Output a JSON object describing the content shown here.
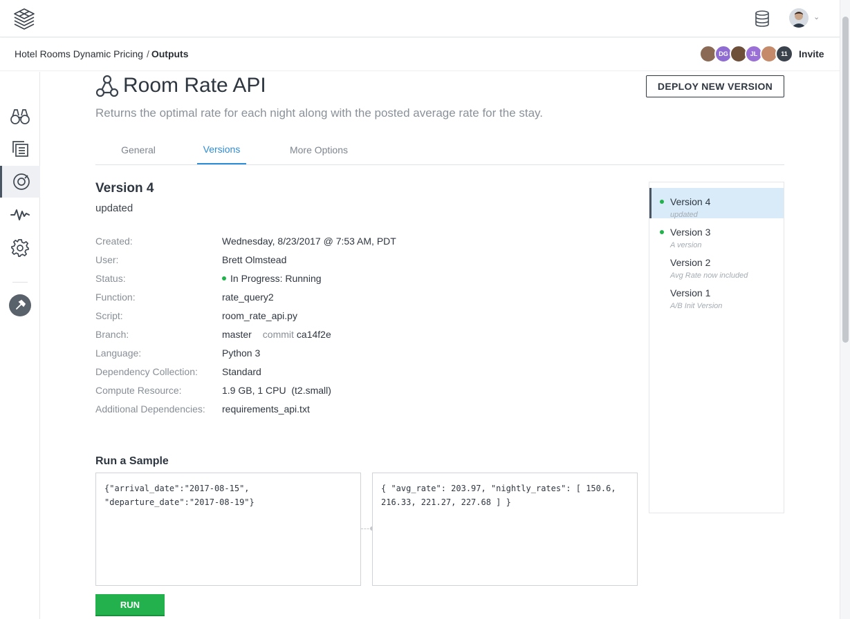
{
  "topbar": {
    "logo_icon": "stacked-layers-logo-icon",
    "database_icon": "database-icon",
    "user_menu_chevron": "⌄"
  },
  "breadcrumb": {
    "project": "Hotel Rooms Dynamic Pricing",
    "separator": "/",
    "current": "Outputs"
  },
  "collaborators": [
    {
      "initials": "",
      "color": "#8a6a55"
    },
    {
      "initials": "DG",
      "color": "#8e6cd1"
    },
    {
      "initials": "",
      "color": "#6d4f3a"
    },
    {
      "initials": "JL",
      "color": "#9a6fd6"
    },
    {
      "initials": "",
      "color": "#c48a6a"
    },
    {
      "initials": "11",
      "color": "#3a424c"
    }
  ],
  "invite_label": "Invite",
  "rail": {
    "items": [
      {
        "icon": "binoculars-icon",
        "active": false
      },
      {
        "icon": "documents-icon",
        "active": false
      },
      {
        "icon": "outputs-icon",
        "active": true
      },
      {
        "icon": "activity-icon",
        "active": false
      },
      {
        "icon": "gear-icon",
        "active": false
      }
    ],
    "tool_icon": "hammer-icon"
  },
  "header": {
    "title": "Room Rate API",
    "title_icon": "api-nodes-icon",
    "subtitle": "Returns the optimal rate for each night along with the posted average rate for the stay.",
    "deploy_button": "DEPLOY NEW VERSION"
  },
  "tabs": [
    {
      "label": "General",
      "active": false
    },
    {
      "label": "Versions",
      "active": true
    },
    {
      "label": "More Options",
      "active": false
    }
  ],
  "version": {
    "title": "Version 4",
    "subtitle": "updated",
    "details": [
      {
        "label": "Created:",
        "value": "Wednesday, 8/23/2017 @ 7:53 AM, PDT"
      },
      {
        "label": "User:",
        "value": "Brett Olmstead"
      },
      {
        "label": "Status:",
        "value": "In Progress: Running"
      },
      {
        "label": "Function:",
        "value": "rate_query2"
      },
      {
        "label": "Script:",
        "value": "room_rate_api.py"
      },
      {
        "label": "Branch:",
        "value": "master",
        "extra_label": "commit",
        "extra_value": "ca14f2e"
      },
      {
        "label": "Language:",
        "value": "Python 3"
      },
      {
        "label": "Dependency Collection:",
        "value": "Standard"
      },
      {
        "label": "Compute Resource:",
        "value": "1.9 GB, 1 CPU  (t2.small)"
      },
      {
        "label": "Additional Dependencies:",
        "value": "requirements_api.txt"
      }
    ],
    "status_color": "#21b24b"
  },
  "sample": {
    "title": "Run a Sample",
    "input": "{\"arrival_date\":\"2017-08-15\",\n\"departure_date\":\"2017-08-19\"}",
    "output": "{ \"avg_rate\": 203.97, \"nightly_rates\": [ 150.6,\n216.33, 221.27, 227.68 ] }",
    "run_button": "RUN"
  },
  "versions_list": [
    {
      "name": "Version 4",
      "desc": "updated",
      "live": true,
      "active": true
    },
    {
      "name": "Version 3",
      "desc": "A version",
      "live": true,
      "active": false
    },
    {
      "name": "Version 2",
      "desc": "Avg Rate now included",
      "live": false,
      "active": false
    },
    {
      "name": "Version 1",
      "desc": "A/B Init Version",
      "live": false,
      "active": false
    }
  ],
  "colors": {
    "accent": "#2d8cd6",
    "run_green": "#22b14c",
    "active_version_bg": "#d9ebf9"
  }
}
